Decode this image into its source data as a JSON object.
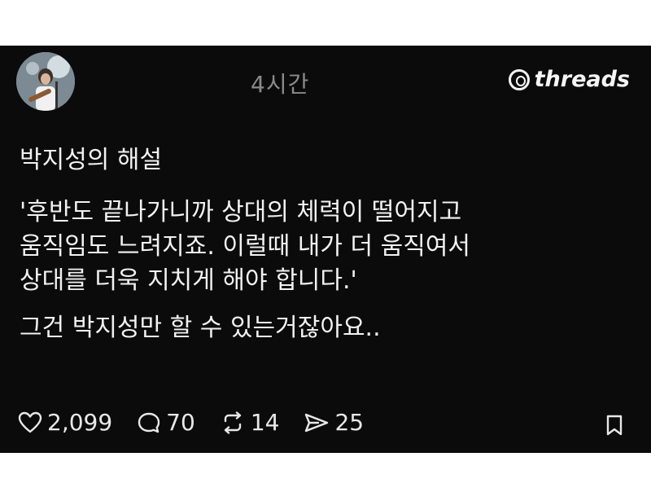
{
  "post": {
    "timestamp": "4시간",
    "brand": "threads",
    "title": "박지성의 해설",
    "quote": "'후반도 끝나가니까 상대의 체력이 떨어지고\n움직임도 느려지죠. 이럴때 내가 더 움직여서\n상대를 더욱 지치게 해야 합니다.'",
    "comment": "그건 박지성만 할 수 있는거잖아요.."
  },
  "actions": {
    "likes": "2,099",
    "replies": "70",
    "reposts": "14",
    "shares": "25"
  },
  "icons": {
    "avatar": "avatar",
    "like": "heart-icon",
    "reply": "speech-bubble-icon",
    "repost": "repost-icon",
    "share": "send-icon",
    "bookmark": "bookmark-icon"
  },
  "colors": {
    "background": "#0b0b0b",
    "text": "#f2f2f2",
    "muted": "#8a8a8a"
  }
}
